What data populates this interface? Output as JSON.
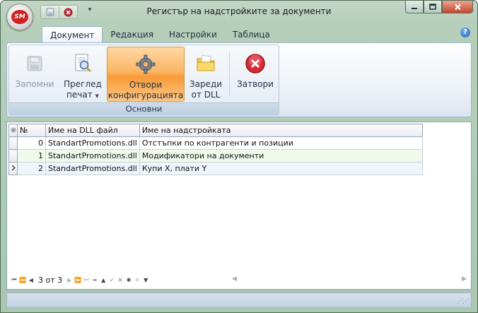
{
  "window": {
    "title": "Регистър на надстройките за документи",
    "app_logo": "SM"
  },
  "quick_access": {
    "items": [
      "save-icon",
      "close-doc-icon"
    ],
    "more_glyph": "▾"
  },
  "ribbon": {
    "tabs": [
      "Документ",
      "Редакция",
      "Настройки",
      "Таблица"
    ],
    "active_tab": "Документ",
    "help_label": "?",
    "group_label": "Основни",
    "buttons": {
      "save": {
        "line1": "Запомни",
        "line2": "",
        "enabled": false
      },
      "preview": {
        "line1": "Преглед",
        "line2": "печат",
        "enabled": true
      },
      "open_config": {
        "line1": "Отвори",
        "line2": "конфигурацията",
        "enabled": true,
        "highlighted": true
      },
      "load_dll": {
        "line1": "Зареди",
        "line2": "от DLL",
        "enabled": true
      },
      "close": {
        "line1": "Затвори",
        "line2": "",
        "enabled": true
      }
    }
  },
  "grid": {
    "columns": [
      "№",
      "Име на DLL файл",
      "Име на надстройката"
    ],
    "rows": [
      {
        "no": "0",
        "dll": "StandartPromotions.dll",
        "name": "Отстъпки по контрагенти и позиции"
      },
      {
        "no": "1",
        "dll": "StandartPromotions.dll",
        "name": "Модификатори на документи"
      },
      {
        "no": "2",
        "dll": "StandartPromotions.dll",
        "name": "Купи Х, плати Y"
      }
    ],
    "current_row": 2
  },
  "navigator": {
    "position_text": "3 от 3"
  },
  "colors": {
    "frame": "#b6cfbb",
    "ribbon_highlight": "#f89a38",
    "alt_row": "#f1f9ec",
    "selected_row": "#eef5fb"
  }
}
